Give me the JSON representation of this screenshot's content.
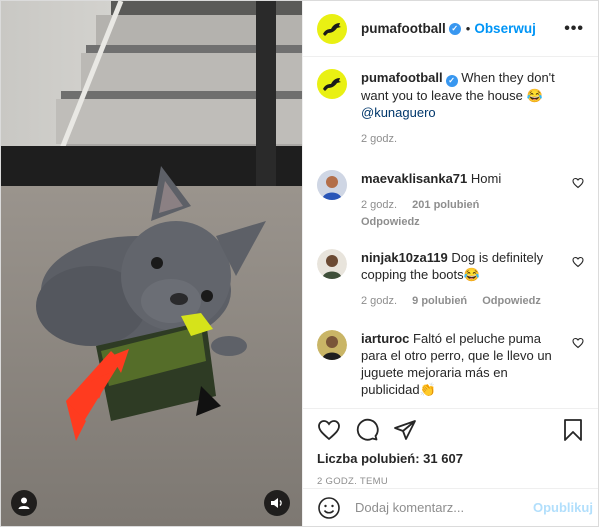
{
  "header": {
    "username": "pumafootball",
    "separator": "•",
    "follow_label": "Obserwuj",
    "more_label": "•••"
  },
  "caption": {
    "username": "pumafootball",
    "text": "When they don't want you to leave the house 😂",
    "mention": "@kunaguero",
    "time": "2 godz."
  },
  "comments": [
    {
      "username": "maevaklisanka71",
      "text": "Homi",
      "time": "2 godz.",
      "likes": "201 polubień",
      "reply": "Odpowiedz"
    },
    {
      "username": "ninjak10za119",
      "text": "Dog is definitely copping the boots😂",
      "time": "2 godz.",
      "likes": "9 polubień",
      "reply": "Odpowiedz"
    },
    {
      "username": "iarturoc",
      "text": "Faltó el peluche puma para el otro perro, que le llevo un juguete mejoraria más en publicidad👏",
      "time": "",
      "likes": "",
      "reply": ""
    }
  ],
  "likes_text": "Liczba polubień: 31 607",
  "time_ago": "2 GODZ. TEMU",
  "add_comment": {
    "placeholder": "Dodaj komentarz...",
    "publish_label": "Opublikuj"
  },
  "colors": {
    "accent": "#0095f6",
    "puma_yellow": "#e9f013",
    "verified": "#3897f0"
  }
}
